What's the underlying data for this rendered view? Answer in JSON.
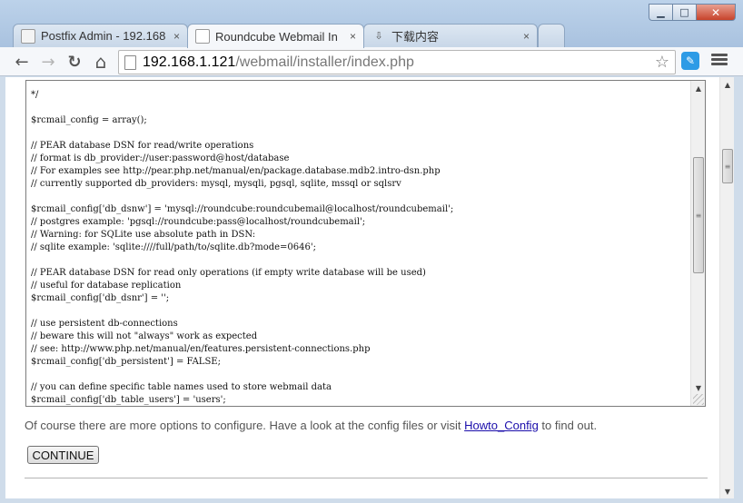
{
  "window": {
    "controls": {
      "minimize": "▁",
      "maximize": "□",
      "close": "✕"
    }
  },
  "tabs": [
    {
      "title": "Postfix Admin - 192.168",
      "close": "×",
      "favicon": "postfix-favicon",
      "active": false
    },
    {
      "title": "Roundcube Webmail In",
      "close": "×",
      "favicon": "roundcube-favicon",
      "active": true
    },
    {
      "title": "下载内容",
      "close": "×",
      "favicon": "download-icon",
      "active": false
    }
  ],
  "toolbar": {
    "back": "←",
    "forward": "→",
    "reload": "↻",
    "home": "⌂",
    "url_host": "192.168.1.121",
    "url_path": "/webmail/installer/index.php",
    "star": "☆"
  },
  "config_code": [
    "*/",
    "",
    "$rcmail_config = array();",
    "",
    "// PEAR database DSN for read/write operations",
    "// format is db_provider://user:password@host/database",
    "// For examples see http://pear.php.net/manual/en/package.database.mdb2.intro-dsn.php",
    "// currently supported db_providers: mysql, mysqli, pgsql, sqlite, mssql or sqlsrv",
    "",
    "$rcmail_config['db_dsnw'] = 'mysql://roundcube:roundcubemail@localhost/roundcubemail';",
    "// postgres example: 'pgsql://roundcube:pass@localhost/roundcubemail';",
    "// Warning: for SQLite use absolute path in DSN:",
    "// sqlite example: 'sqlite:////full/path/to/sqlite.db?mode=0646';",
    "",
    "// PEAR database DSN for read only operations (if empty write database will be used)",
    "// useful for database replication",
    "$rcmail_config['db_dsnr'] = '';",
    "",
    "// use persistent db-connections",
    "// beware this will not \"always\" work as expected",
    "// see: http://www.php.net/manual/en/features.persistent-connections.php",
    "$rcmail_config['db_persistent'] = FALSE;",
    "",
    "// you can define specific table names used to store webmail data",
    "$rcmail_config['db_table_users'] = 'users';"
  ],
  "note": {
    "before": "Of course there are more options to configure. Have a look at the config files or visit ",
    "link": "Howto_Config",
    "after": " to find out."
  },
  "continue_label": "CONTINUE"
}
